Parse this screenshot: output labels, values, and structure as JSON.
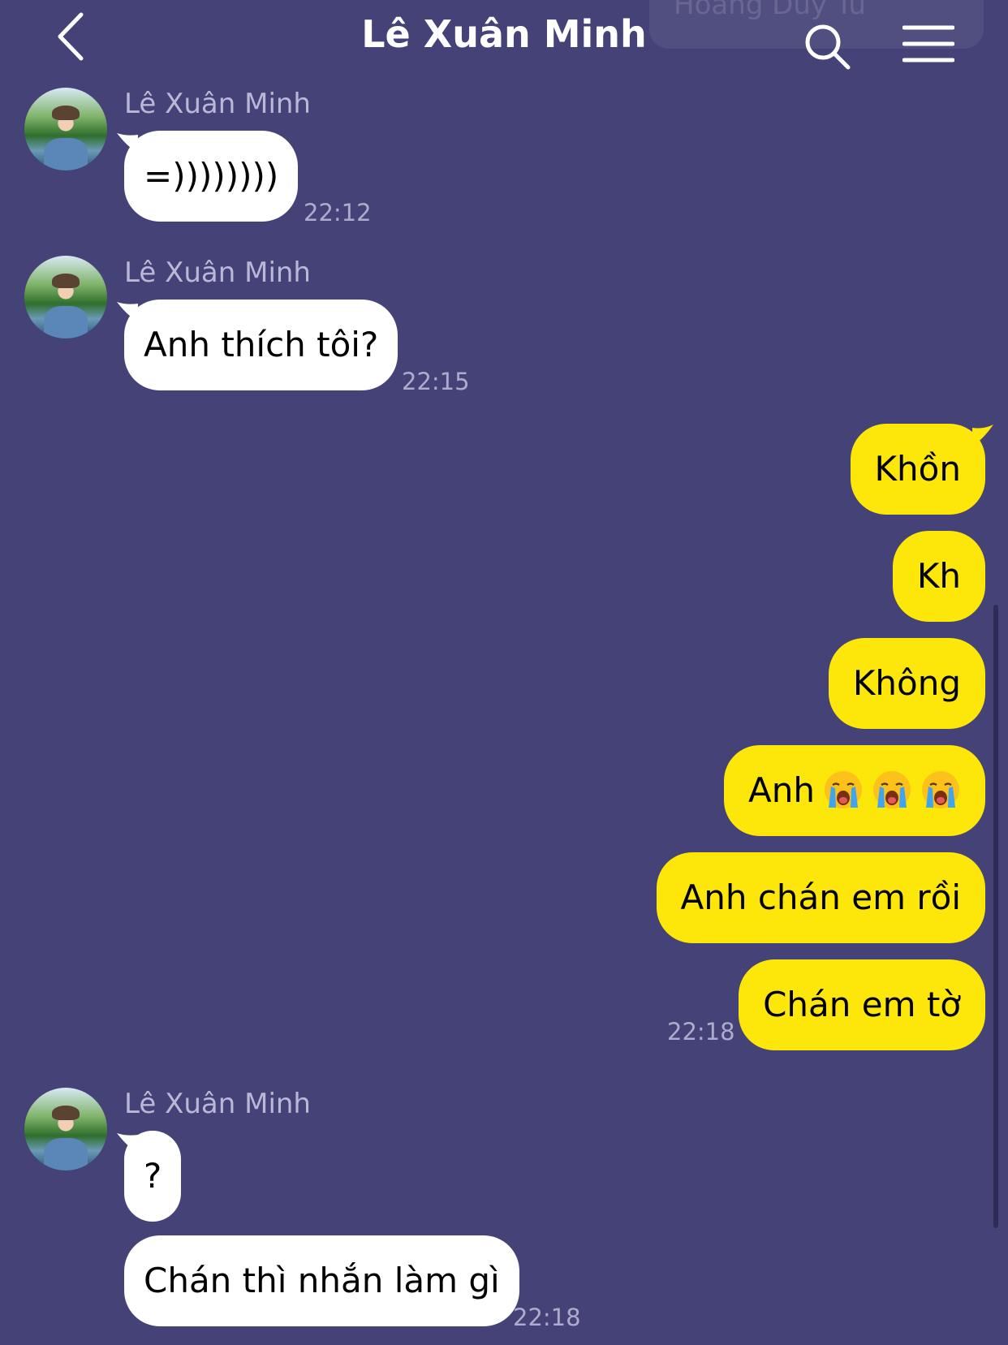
{
  "header": {
    "title": "Lê Xuân Minh",
    "ghost_overlay": "Hoàng Duy Tú"
  },
  "icons": {
    "back": "chevron-left-icon",
    "search": "search-icon",
    "menu": "hamburger-menu-icon",
    "emoji": "loudly-crying-face-emoji"
  },
  "colors": {
    "background": "#444276",
    "incoming_bubble": "#ffffff",
    "outgoing_bubble": "#fde609",
    "meta_text": "#b9b8d6"
  },
  "messages": {
    "g1": {
      "sender": "Lê Xuân Minh",
      "text": "=))))))))",
      "time": "22:12"
    },
    "g2": {
      "sender": "Lê Xuân Minh",
      "text": "Anh thích tôi?",
      "time": "22:15"
    },
    "out": {
      "m1": "Khồn",
      "m2": "Kh",
      "m3": "Không",
      "m4": "Anh",
      "m5": "Anh chán em rồi",
      "m6": "Chán em tờ",
      "time": "22:18"
    },
    "g3": {
      "sender": "Lê Xuân Minh",
      "text1": "?",
      "text2": "Chán thì nhắn làm gì",
      "time": "22:18"
    }
  }
}
